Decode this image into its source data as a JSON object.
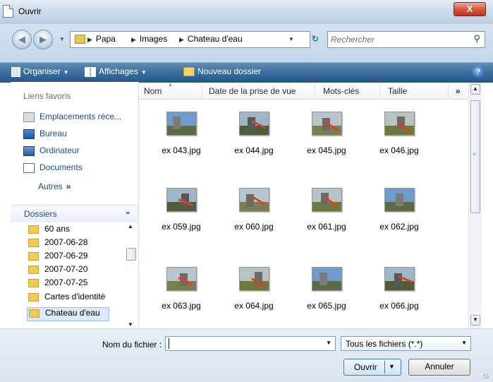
{
  "window": {
    "title": "Ouvrir",
    "close_label": "X"
  },
  "address": {
    "crumbs": [
      "Papa",
      "Images",
      "Chateau d'eau"
    ],
    "search_placeholder": "Rechercher"
  },
  "toolbar": {
    "organiser": "Organiser",
    "affichages": "Affichages",
    "nouveau_dossier": "Nouveau dossier",
    "help": "?"
  },
  "sidebar": {
    "favorites_header": "Liens favoris",
    "favorites": [
      "Emplacements réce...",
      "Bureau",
      "Ordinateur",
      "Documents"
    ],
    "more": "Autres",
    "more_glyph": "»",
    "folders_header": "Dossiers",
    "folders": [
      "60 ans",
      "2007-06-28",
      "2007-06-29",
      "2007-07-20",
      "2007-07-25",
      "Cartes d'identité",
      "Chateau d'eau"
    ],
    "selected_folder": "Chateau d'eau"
  },
  "columns": [
    "Nom",
    "Date de la prise de vue",
    "Mots-clés",
    "Taille",
    "»"
  ],
  "files": [
    {
      "name": "ex 043.jpg",
      "icon": "photo-thumbnail"
    },
    {
      "name": "ex 044.jpg",
      "icon": "photo-thumbnail"
    },
    {
      "name": "ex 045.jpg",
      "icon": "photo-thumbnail"
    },
    {
      "name": "ex 046.jpg",
      "icon": "photo-thumbnail"
    },
    {
      "name": "ex 059.jpg",
      "icon": "photo-thumbnail"
    },
    {
      "name": "ex 060.jpg",
      "icon": "photo-thumbnail"
    },
    {
      "name": "ex 061.jpg",
      "icon": "photo-thumbnail"
    },
    {
      "name": "ex 062.jpg",
      "icon": "photo-thumbnail"
    },
    {
      "name": "ex 063.jpg",
      "icon": "photo-thumbnail"
    },
    {
      "name": "ex 064.jpg",
      "icon": "photo-thumbnail"
    },
    {
      "name": "ex 065.jpg",
      "icon": "photo-thumbnail"
    },
    {
      "name": "ex 066.jpg",
      "icon": "photo-thumbnail"
    }
  ],
  "footer": {
    "filename_label": "Nom du fichier :",
    "filename_value": "",
    "filter": "Tous les fichiers (*.*)",
    "open": "Ouvrir",
    "cancel": "Annuler"
  },
  "colors": {
    "toolbar": "#3b6e9e",
    "link": "#1d4b8a",
    "close": "#c6301b"
  }
}
